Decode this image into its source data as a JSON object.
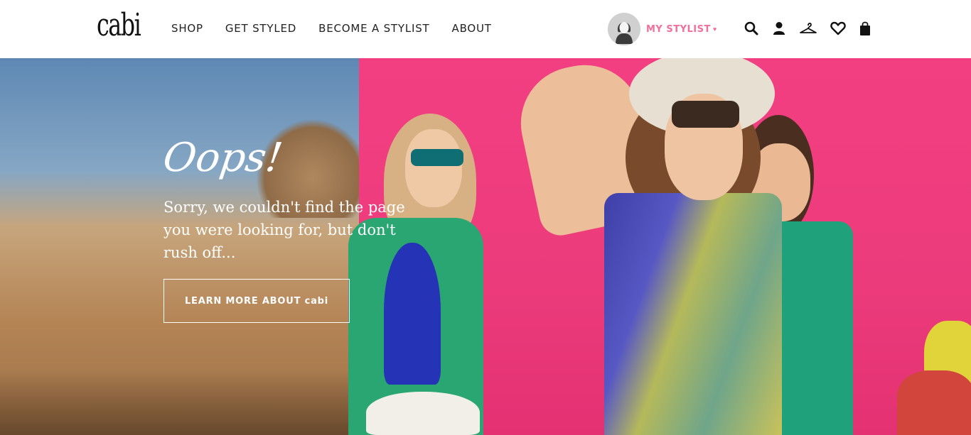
{
  "header": {
    "logo": "cabi",
    "nav": [
      "SHOP",
      "GET STYLED",
      "BECOME A STYLIST",
      "ABOUT"
    ],
    "stylist_label": "MY STYLIST",
    "icons": [
      "search-icon",
      "account-icon",
      "hanger-icon",
      "heart-icon",
      "bag-icon"
    ]
  },
  "hero": {
    "heading": "Oops!",
    "message": "Sorry, we couldn't find the page you were looking for, but don't rush off...",
    "cta_label": "LEARN MORE ABOUT cabi"
  },
  "colors": {
    "accent_pink": "#f0709a",
    "hero_pink": "#ec3b7b"
  }
}
